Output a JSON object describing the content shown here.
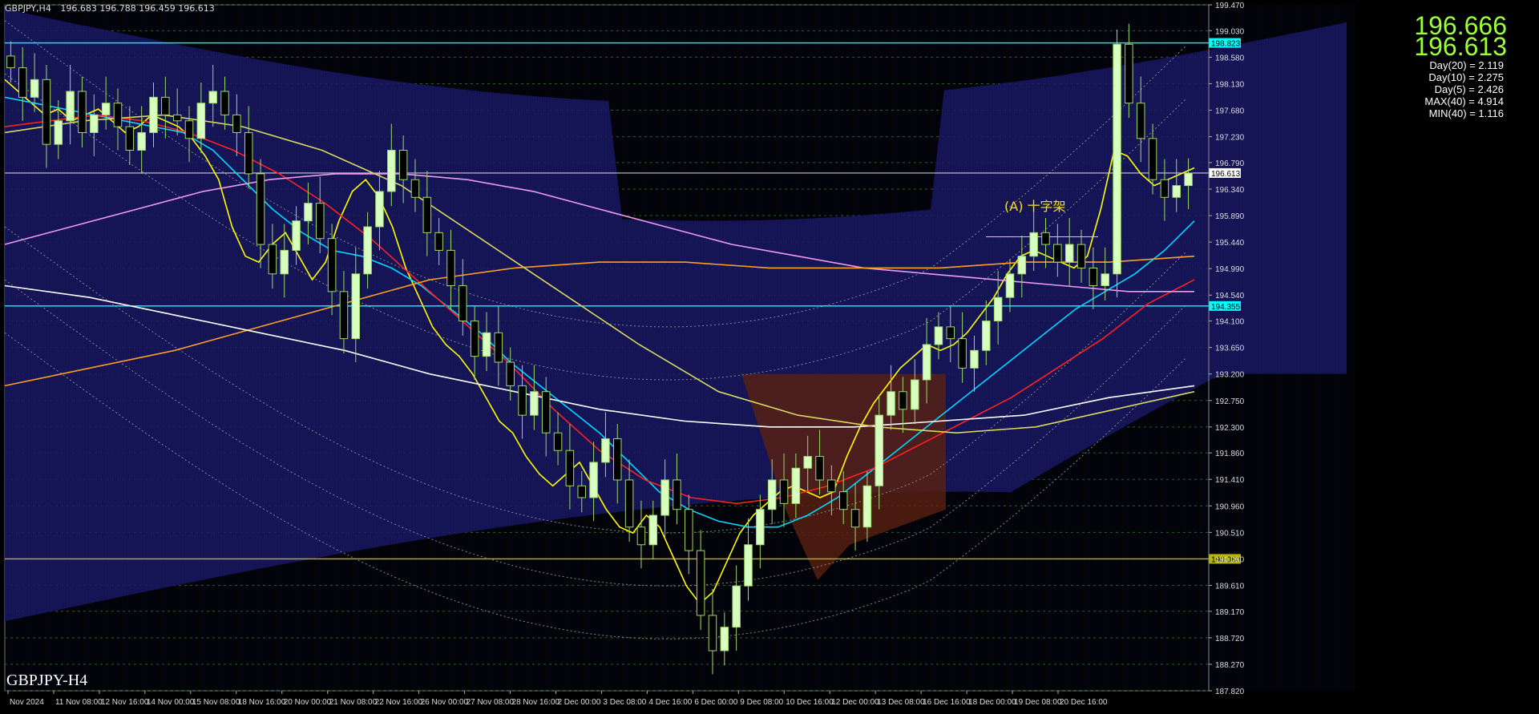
{
  "header": {
    "symbol": "GBPJPY,H4",
    "ohlc": "196.683 196.788 196.459 196.613"
  },
  "price_labels": {
    "bid": "196.666",
    "ask": "196.613"
  },
  "stats": [
    "Day(20) = 2.119",
    "Day(10) = 2.275",
    "Day(5) = 2.426",
    "MAX(40) = 4.914",
    "MIN(40) = 1.116"
  ],
  "watermark": "GBPJPY-H4",
  "annotation": "(A) 十字架",
  "colors": {
    "bg": "#000000",
    "bull": "#c8ffa0",
    "bear": "#9ed96a",
    "ichimoku_cloud": "#1c1c6e",
    "hline": "#00ffff",
    "current": "#ffffff"
  },
  "chart_data": {
    "type": "line",
    "ylim": [
      187.82,
      199.47
    ],
    "yticks": [
      "199.470",
      "199.030",
      "198.580",
      "198.130",
      "197.680",
      "197.230",
      "196.790",
      "196.340",
      "195.890",
      "195.440",
      "194.990",
      "194.540",
      "194.100",
      "193.650",
      "193.200",
      "192.750",
      "192.300",
      "191.860",
      "191.410",
      "190.960",
      "190.510",
      "190.060",
      "189.610",
      "189.170",
      "188.720",
      "188.270",
      "187.820"
    ],
    "xticks": [
      "Nov 2024",
      "11 Nov 08:00",
      "12 Nov 16:00",
      "14 Nov 00:00",
      "15 Nov 08:00",
      "18 Nov 16:00",
      "20 Nov 00:00",
      "21 Nov 08:00",
      "22 Nov 16:00",
      "26 Nov 00:00",
      "27 Nov 08:00",
      "28 Nov 16:00",
      "2 Dec 00:00",
      "3 Dec 08:00",
      "4 Dec 16:00",
      "6 Dec 00:00",
      "9 Dec 08:00",
      "10 Dec 16:00",
      "12 Dec 00:00",
      "13 Dec 08:00",
      "16 Dec 16:00",
      "18 Dec 00:00",
      "19 Dec 08:00",
      "20 Dec 16:00"
    ],
    "horizontal_lines": [
      {
        "price": 198.823,
        "label": "198.823",
        "color": "#00ffff"
      },
      {
        "price": 194.355,
        "label": "194.355",
        "color": "#00ffff"
      },
      {
        "price": 196.613,
        "label": "196.613",
        "color": "#ffffff"
      },
      {
        "price": 190.06,
        "label": "190.060",
        "color": "#b8b800"
      }
    ],
    "close_series": [
      198.4,
      197.9,
      198.2,
      197.1,
      197.5,
      198.0,
      197.3,
      197.6,
      197.8,
      197.4,
      197.0,
      197.3,
      197.9,
      197.6,
      197.5,
      197.2,
      197.8,
      198.0,
      197.6,
      197.3,
      196.6,
      195.4,
      194.9,
      195.3,
      195.8,
      196.1,
      195.5,
      194.6,
      193.8,
      194.9,
      195.7,
      196.3,
      197.0,
      196.5,
      196.2,
      195.6,
      195.3,
      194.7,
      194.1,
      193.5,
      193.9,
      193.4,
      193.0,
      192.5,
      192.9,
      192.2,
      191.9,
      191.3,
      191.1,
      191.7,
      192.1,
      191.4,
      190.6,
      190.3,
      190.8,
      191.4,
      190.9,
      190.2,
      189.1,
      188.5,
      188.9,
      189.6,
      190.3,
      190.9,
      191.4,
      191.0,
      191.6,
      191.8,
      191.4,
      191.2,
      190.9,
      190.6,
      191.3,
      192.5,
      192.9,
      192.6,
      193.1,
      193.7,
      194.0,
      193.8,
      193.3,
      193.6,
      194.1,
      194.5,
      194.9,
      195.2,
      195.6,
      195.4,
      195.1,
      195.4,
      195.0,
      194.7,
      194.9,
      198.8,
      197.8,
      197.2,
      196.5,
      196.2,
      196.4,
      196.613
    ],
    "overlays": [
      {
        "name": "MA-yellow",
        "color": "#ffff00",
        "values": [
          198.2,
          198.0,
          197.8,
          197.6,
          197.7,
          197.5,
          197.6,
          197.7,
          197.5,
          197.3,
          197.4,
          197.6,
          197.5,
          197.4,
          197.2,
          196.9,
          196.5,
          195.7,
          195.2,
          195.1,
          195.4,
          195.6,
          195.2,
          194.8,
          195.1,
          195.8,
          196.3,
          196.5,
          196.2,
          195.7,
          195.0,
          194.5,
          194.0,
          193.7,
          193.5,
          193.2,
          192.8,
          192.4,
          192.2,
          191.8,
          191.5,
          191.3,
          191.5,
          191.7,
          191.3,
          190.9,
          190.6,
          190.5,
          190.8,
          190.6,
          190.1,
          189.6,
          189.3,
          189.5,
          190.0,
          190.5,
          190.8,
          191.0,
          191.2,
          191.3,
          191.2,
          191.1,
          191.2,
          191.8,
          192.3,
          192.7,
          193.0,
          193.3,
          193.5,
          193.7,
          193.6,
          193.7,
          193.9,
          194.2,
          194.5,
          194.9,
          195.2,
          195.3,
          195.2,
          195.1,
          195.0,
          195.2,
          196.0,
          197.0,
          196.9,
          196.6,
          196.4,
          196.5,
          196.6,
          196.7
        ]
      },
      {
        "name": "MA-cyan",
        "color": "#00d8ff",
        "values": [
          197.9,
          197.8,
          197.7,
          197.6,
          197.5,
          197.4,
          197.3,
          197.0,
          196.5,
          196.0,
          195.6,
          195.3,
          195.2,
          195.0,
          194.7,
          194.3,
          193.9,
          193.4,
          193.0,
          192.6,
          192.2,
          191.7,
          191.2,
          190.9,
          190.7,
          190.6,
          190.6,
          190.8,
          191.1,
          191.5,
          191.9,
          192.3,
          192.7,
          193.1,
          193.5,
          193.9,
          194.3,
          194.6,
          194.9,
          195.3,
          195.8
        ]
      },
      {
        "name": "MA-red",
        "color": "#ff2020",
        "values": [
          197.4,
          197.5,
          197.6,
          197.5,
          197.3,
          197.0,
          196.6,
          196.1,
          195.5,
          194.8,
          194.1,
          193.4,
          192.6,
          191.9,
          191.4,
          191.1,
          191.0,
          191.1,
          191.3,
          191.6,
          192.0,
          192.4,
          192.8,
          193.3,
          193.8,
          194.4,
          194.8
        ]
      },
      {
        "name": "MA-pink",
        "color": "#ee99ee",
        "values": [
          195.4,
          195.7,
          196.0,
          196.3,
          196.5,
          196.6,
          196.6,
          196.5,
          196.3,
          196.0,
          195.7,
          195.4,
          195.2,
          195.0,
          194.9,
          194.8,
          194.7,
          194.6,
          194.6
        ]
      },
      {
        "name": "MA-orange",
        "color": "#ffa020",
        "values": [
          193.0,
          193.3,
          193.6,
          194.0,
          194.4,
          194.8,
          195.0,
          195.1,
          195.1,
          195.0,
          195.0,
          195.0,
          195.1,
          195.1,
          195.2
        ]
      },
      {
        "name": "MA-white",
        "color": "#ffffff",
        "values": [
          194.7,
          194.5,
          194.2,
          193.9,
          193.6,
          193.2,
          192.9,
          192.6,
          192.4,
          192.3,
          192.3,
          192.4,
          192.5,
          192.8,
          193.0
        ]
      },
      {
        "name": "MA-olive",
        "color": "#d8d860",
        "values": [
          197.3,
          197.5,
          197.6,
          197.4,
          197.0,
          196.4,
          195.5,
          194.6,
          193.7,
          192.9,
          192.5,
          192.3,
          192.2,
          192.3,
          192.6,
          192.9
        ]
      }
    ]
  }
}
